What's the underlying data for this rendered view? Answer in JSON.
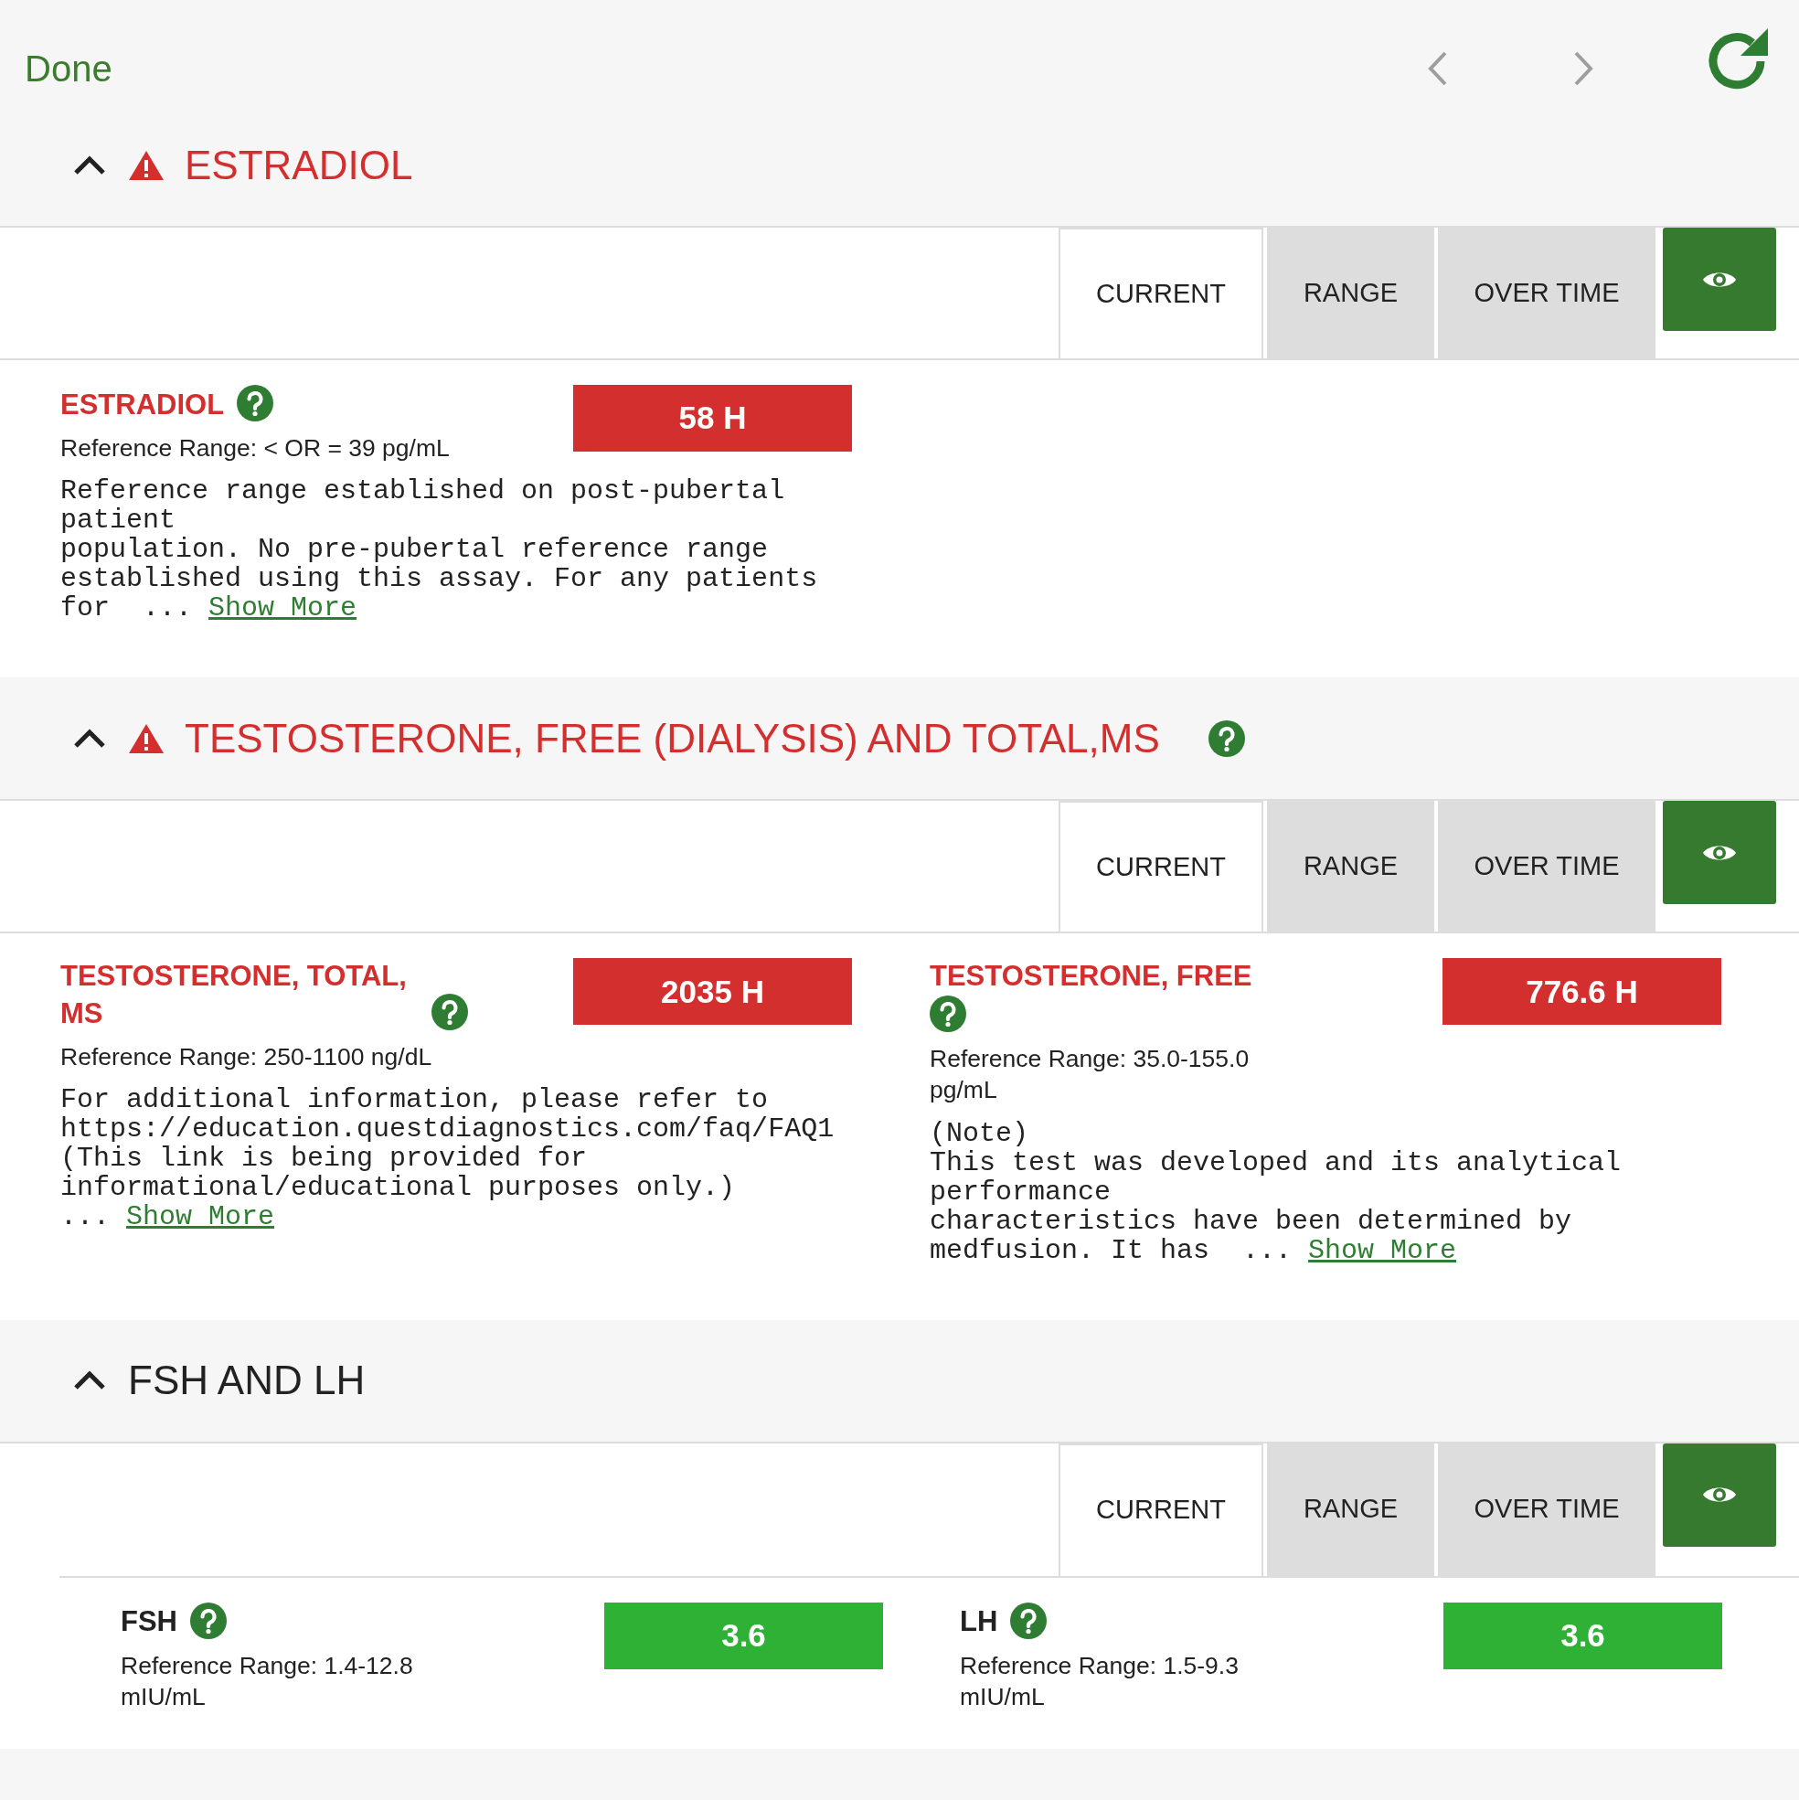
{
  "top_bar": {
    "done_label": "Done"
  },
  "sections": [
    {
      "title": "ESTRADIOL",
      "alert": true,
      "expanded": true,
      "help": false,
      "tabs": [
        {
          "label": "CURRENT",
          "selected": true
        },
        {
          "label": "RANGE",
          "selected": false
        },
        {
          "label": "OVER TIME",
          "selected": false
        }
      ],
      "results": [
        {
          "name": "ESTRADIOL",
          "value": "58 H",
          "alert": true,
          "color": "#d32f2f",
          "reference": "Reference Range: < OR = 39 pg/mL",
          "note": "Reference range established on post-pubertal patient\npopulation. No pre-pubertal reference range\nestablished using this assay. For any patients\nfor  ...",
          "show_more": "Show More"
        }
      ]
    },
    {
      "title": "TESTOSTERONE, FREE (DIALYSIS) AND TOTAL,MS",
      "alert": true,
      "expanded": true,
      "help": true,
      "tabs": [
        {
          "label": "CURRENT",
          "selected": true
        },
        {
          "label": "RANGE",
          "selected": false
        },
        {
          "label": "OVER TIME",
          "selected": false
        }
      ],
      "results": [
        {
          "name": "TESTOSTERONE, TOTAL, MS",
          "value": "2035 H",
          "alert": true,
          "color": "#d32f2f",
          "reference": "Reference Range: 250-1100 ng/dL",
          "note": "For additional information, please refer to\nhttps://education.questdiagnostics.com/faq/FAQ1\n(This link is being provided for\ninformational/educational purposes only.)\n...",
          "show_more": "Show More"
        },
        {
          "name": "TESTOSTERONE, FREE",
          "value": "776.6 H",
          "alert": true,
          "color": "#d32f2f",
          "reference": "Reference Range: 35.0-155.0 pg/mL",
          "note": "(Note)\nThis test was developed and its analytical performance\ncharacteristics have been determined by\nmedfusion. It has  ...",
          "show_more": "Show More"
        }
      ]
    },
    {
      "title": "FSH AND LH",
      "alert": false,
      "expanded": true,
      "help": false,
      "tabs": [
        {
          "label": "CURRENT",
          "selected": true
        },
        {
          "label": "RANGE",
          "selected": false
        },
        {
          "label": "OVER TIME",
          "selected": false
        }
      ],
      "results": [
        {
          "name": "FSH",
          "value": "3.6",
          "alert": false,
          "color": "#2eb135",
          "reference": "Reference Range: 1.4-12.8 mIU/mL"
        },
        {
          "name": "LH",
          "value": "3.6",
          "alert": false,
          "color": "#2eb135",
          "reference": "Reference Range: 1.5-9.3 mIU/mL"
        }
      ]
    }
  ]
}
